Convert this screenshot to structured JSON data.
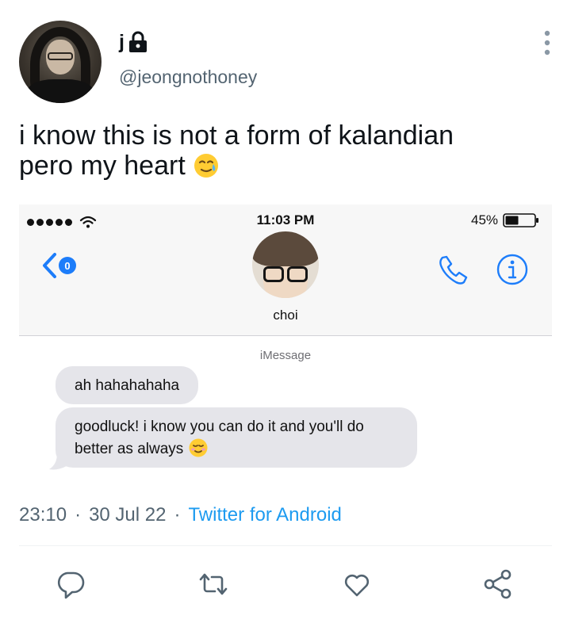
{
  "author": {
    "display_name": "j",
    "handle": "@jeongnothoney",
    "protected": true
  },
  "tweet": {
    "text_lines": [
      "i know this is not a form of kalandian",
      "pero my heart"
    ],
    "emoji": "smiling-face-with-tear",
    "time": "23:10",
    "separator": "·",
    "date": "30 Jul 22",
    "source": "Twitter for Android"
  },
  "screenshot": {
    "status_time": "11:03 PM",
    "battery": "45%",
    "back_badge": "0",
    "contact_name": "choi",
    "service_label": "iMessage",
    "messages": [
      {
        "text": "ah hahahahaha"
      },
      {
        "line1": "goodluck! i know you can do it and you'll do",
        "line2": "better as always",
        "emoji": "smiling-face"
      }
    ]
  },
  "actions": [
    "reply-icon",
    "retweet-icon",
    "like-icon",
    "share-icon"
  ],
  "colors": {
    "text": "#0f1419",
    "secondary": "#536471",
    "link": "#1d9bf0",
    "ios_blue": "#1d7dfa",
    "bubble": "#e5e5ea"
  }
}
